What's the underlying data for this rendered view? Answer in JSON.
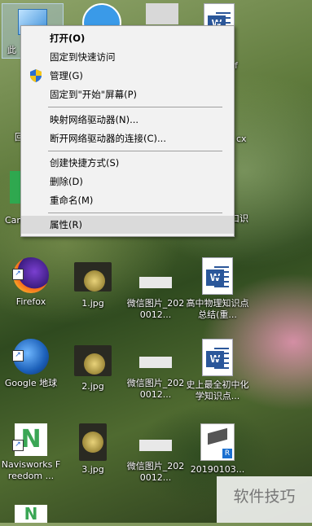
{
  "context_menu": {
    "items": [
      {
        "label": "打开(O)"
      },
      {
        "label": "固定到快速访问"
      },
      {
        "label": "管理(G)"
      },
      {
        "label": "固定到\"开始\"屏幕(P)"
      },
      {
        "label": "映射网络驱动器(N)..."
      },
      {
        "label": "断开网络驱动器的连接(C)..."
      },
      {
        "label": "创建快捷方式(S)"
      },
      {
        "label": "删除(D)"
      },
      {
        "label": "重命名(M)"
      },
      {
        "label": "属性(R)"
      }
    ]
  },
  "desktop_icons": {
    "firefox": "Firefox",
    "jpg1": "1.jpg",
    "wx1": "微信图片_2020012...",
    "doc1": "高中物理知识点总结(重...",
    "google": "Google 地球",
    "jpg2": "2.jpg",
    "wx2": "微信图片_2020012...",
    "doc2": "史上最全初中化学知识点...",
    "navis": "Navisworks Freedom ...",
    "jpg3": "3.jpg",
    "wx3": "微信图片_2020012...",
    "file2019": "20190103...",
    "partial_left1": "此",
    "partial_left2": "回",
    "partial_left3": "Cam",
    "partial_right1": "f",
    "partial_right2": "cx",
    "partial_right3": "口识"
  },
  "watermark": "软件技巧",
  "colors": {
    "menu_bg": "#f2f2f2",
    "highlight": "#dadada",
    "word_blue": "#2b579a"
  }
}
